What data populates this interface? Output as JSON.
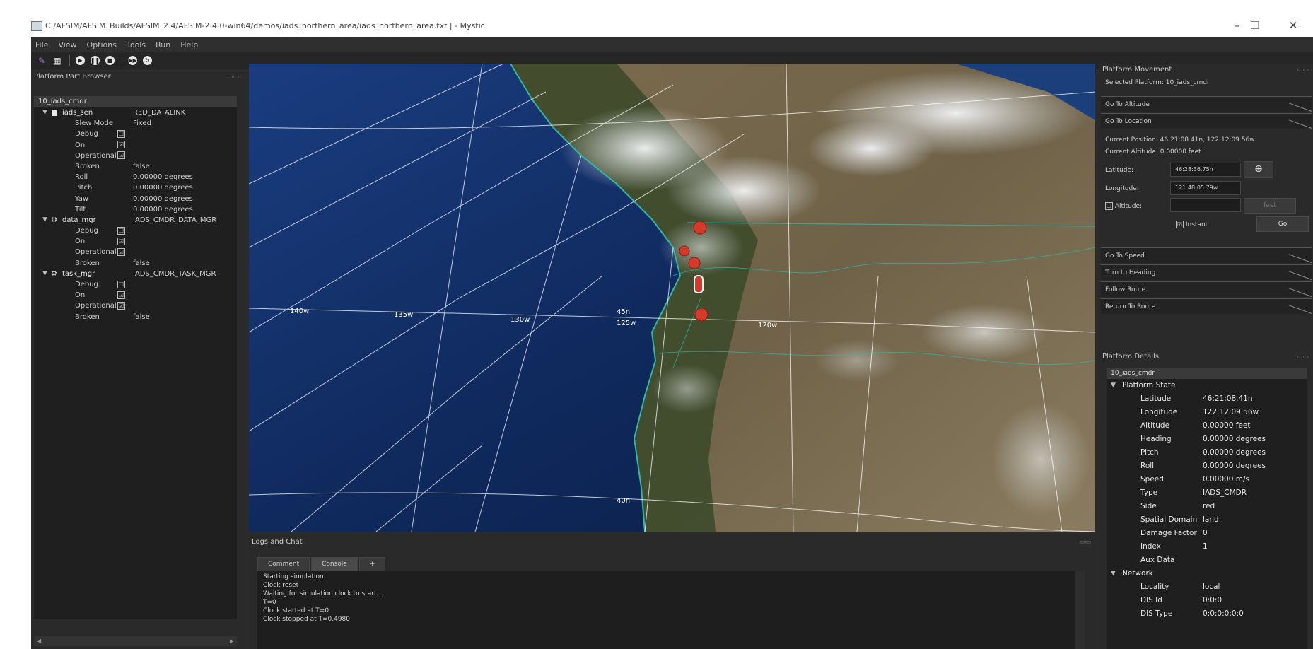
{
  "window": {
    "title": "C:/AFSIM/AFSIM_Builds/AFSIM_2.4/AFSIM-2.4.0-win64/demos/iads_northern_area/iads_northern_area.txt | - Mystic",
    "minimize": "–",
    "restore": "❐",
    "close": "✕"
  },
  "menu": [
    "File",
    "View",
    "Options",
    "Tools",
    "Run",
    "Help"
  ],
  "left_panel": {
    "title": "Platform Part Browser",
    "root": "10_iads_cmdr",
    "rows": [
      {
        "type": "part",
        "name": "iads_sen",
        "value": "RED_DATALINK"
      },
      {
        "type": "prop",
        "key": "Slew Mode",
        "value": "Fixed"
      },
      {
        "type": "prop",
        "key": "Debug",
        "check": "☐"
      },
      {
        "type": "prop",
        "key": "On",
        "check": "☑"
      },
      {
        "type": "prop",
        "key": "Operational",
        "check": "☑"
      },
      {
        "type": "prop",
        "key": "Broken",
        "value": "false"
      },
      {
        "type": "prop",
        "key": "Roll",
        "value": "0.00000 degrees"
      },
      {
        "type": "prop",
        "key": "Pitch",
        "value": "0.00000 degrees"
      },
      {
        "type": "prop",
        "key": "Yaw",
        "value": "0.00000 degrees"
      },
      {
        "type": "prop",
        "key": "Tilt",
        "value": "0.00000 degrees"
      },
      {
        "type": "proc",
        "name": "data_mgr",
        "value": "IADS_CMDR_DATA_MGR"
      },
      {
        "type": "prop",
        "key": "Debug",
        "check": "☐"
      },
      {
        "type": "prop",
        "key": "On",
        "check": "☑"
      },
      {
        "type": "prop",
        "key": "Operational",
        "check": "☑"
      },
      {
        "type": "prop",
        "key": "Broken",
        "value": "false"
      },
      {
        "type": "proc",
        "name": "task_mgr",
        "value": "IADS_CMDR_TASK_MGR"
      },
      {
        "type": "prop",
        "key": "Debug",
        "check": "☐"
      },
      {
        "type": "prop",
        "key": "On",
        "check": "☑"
      },
      {
        "type": "prop",
        "key": "Operational",
        "check": "☑"
      },
      {
        "type": "prop",
        "key": "Broken",
        "value": "false"
      }
    ]
  },
  "map": {
    "grid_labels": [
      "140w",
      "135w",
      "130w",
      "45n",
      "125w",
      "120w",
      "40n"
    ]
  },
  "log": {
    "title": "Logs and Chat",
    "tabs": [
      "Comment",
      "Console",
      "+"
    ],
    "lines": [
      "Starting simulation",
      "Clock reset",
      "Waiting for simulation clock to start...",
      "T=0",
      "Clock started at T=0",
      "Clock stopped at T=0.4980"
    ]
  },
  "movement": {
    "title": "Platform Movement",
    "selected": "Selected Platform: 10_iads_cmdr",
    "sections": [
      "Go To Altitude",
      "Go To Location",
      "Go To Speed",
      "Turn to Heading",
      "Follow Route",
      "Return To Route"
    ],
    "current_position": "Current Position: 46:21:08.41n, 122:12:09.56w",
    "current_altitude": "Current Altitude: 0.00000 feet",
    "latitude_label": "Latitude:",
    "latitude_value": "46:28:36.75n",
    "longitude_label": "Longitude:",
    "longitude_value": "121:48:05.79w",
    "altitude_label": "Altitude:",
    "altitude_check": "☐",
    "instant_label": "Instant",
    "instant_check": "☑",
    "go": "Go",
    "feet": "feet",
    "target_icon": "⊕"
  },
  "details": {
    "title": "Platform Details",
    "root": "10_iads_cmdr",
    "state_group": "Platform State",
    "rows": [
      {
        "k": "Latitude",
        "v": "46:21:08.41n"
      },
      {
        "k": "Longitude",
        "v": "122:12:09.56w"
      },
      {
        "k": "Altitude",
        "v": "0.00000 feet"
      },
      {
        "k": "Heading",
        "v": "0.00000 degrees"
      },
      {
        "k": "Pitch",
        "v": "0.00000 degrees"
      },
      {
        "k": "Roll",
        "v": "0.00000 degrees"
      },
      {
        "k": "Speed",
        "v": "0.00000 m/s"
      },
      {
        "k": "Type",
        "v": "IADS_CMDR"
      },
      {
        "k": "Side",
        "v": "red"
      },
      {
        "k": "Spatial Domain",
        "v": "land"
      },
      {
        "k": "Damage Factor",
        "v": "0"
      },
      {
        "k": "Index",
        "v": "1"
      },
      {
        "k": "Aux Data",
        "v": ""
      }
    ],
    "network_group": "Network",
    "network_rows": [
      {
        "k": "Locality",
        "v": "local"
      },
      {
        "k": "DIS Id",
        "v": "0:0:0"
      },
      {
        "k": "DIS Type",
        "v": "0:0:0:0:0:0"
      }
    ]
  },
  "colors": {
    "ocean": "#102a5e",
    "land": "#6f6248",
    "forest": "#3a4a2a",
    "snow": "#e8ecef",
    "coast": "#2fb8a8",
    "marker": "#d43a2a"
  }
}
